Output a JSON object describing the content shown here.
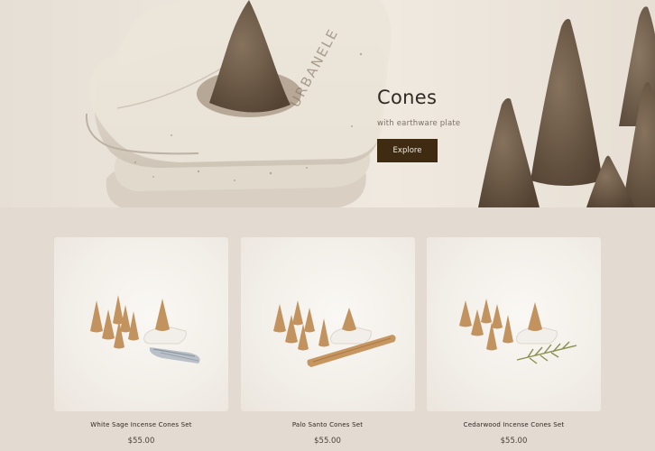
{
  "hero": {
    "title": "Cones",
    "subtitle": "with earthware plate",
    "button_label": "Explore",
    "plate_stamp": "URBANELE"
  },
  "products": [
    {
      "name": "White Sage Incense Cones Set",
      "price": "$55.00",
      "accessory": "white-sage-bundle"
    },
    {
      "name": "Palo Santo Cones Set",
      "price": "$55.00",
      "accessory": "palo-santo-stick"
    },
    {
      "name": "Cedarwood Incense Cones Set",
      "price": "$55.00",
      "accessory": "cedar-sprig"
    }
  ],
  "colors": {
    "page_background": "#e3dbd2",
    "button_background": "#3e2b12",
    "button_text": "#f1e9dc",
    "cone_hero": "#6e5b48",
    "cone_product": "#c2935f"
  }
}
